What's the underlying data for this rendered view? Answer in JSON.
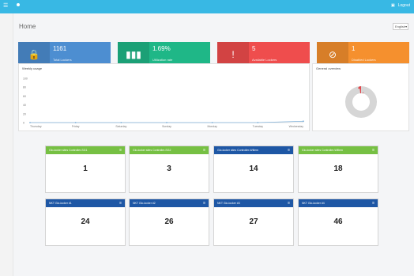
{
  "page": {
    "title": "Home",
    "language": "English"
  },
  "topbar": {
    "menu_icon": "bars-icon",
    "user": "Logout"
  },
  "stats": [
    {
      "value": "1161",
      "label": "Total Lockers",
      "color": "#4d8ed1",
      "icon": "lock-icon"
    },
    {
      "value": "1.69%",
      "label": "Utilization rate",
      "color": "#1fb787",
      "icon": "bar-chart-icon"
    },
    {
      "value": "5",
      "label": "Available Lockers",
      "color": "#ef4d4d",
      "icon": "alert-icon"
    },
    {
      "value": "1",
      "label": "Disabled Lockers",
      "color": "#f5902e",
      "icon": "ban-icon"
    }
  ],
  "weekly_panel": {
    "title": "Weekly usage"
  },
  "status_panel": {
    "title": "General overview"
  },
  "chart_data": [
    {
      "type": "line",
      "title": "Weekly usage",
      "x": [
        "Thursday",
        "Friday",
        "Saturday",
        "Sunday",
        "Monday",
        "Tuesday",
        "Wednesday"
      ],
      "series": [
        {
          "values": [
            0,
            0,
            0,
            0,
            0,
            0,
            3
          ]
        }
      ],
      "ylim": [
        0,
        100
      ],
      "yticks": [
        "100",
        "80",
        "60",
        "40",
        "20",
        "0"
      ],
      "grid": false,
      "color": "#7fb0d8"
    },
    {
      "type": "pie",
      "title": "General overview",
      "slices": [
        {
          "value": 98.3,
          "color": "#d6d6d6"
        },
        {
          "value": 1.7,
          "color": "#e0474c"
        }
      ]
    }
  ],
  "cards": [
    {
      "title": "Glo-locker sites Controller-SG1",
      "number": "1",
      "color": "green"
    },
    {
      "title": "Glo-locker sites Controller-SG2",
      "number": "3",
      "color": "green"
    },
    {
      "title": "Glo-locker sites Controller-Willem",
      "number": "14",
      "color": "blue"
    },
    {
      "title": "Glo-locker sites Controller-Willem",
      "number": "18",
      "color": "green"
    },
    {
      "title": "NKT Glo-locker #1",
      "number": "24",
      "color": "blue"
    },
    {
      "title": "NKT Glo-locker #2",
      "number": "26",
      "color": "blue"
    },
    {
      "title": "NKT Glo-locker #3",
      "number": "27",
      "color": "blue"
    },
    {
      "title": "NKT Glo-locker #4",
      "number": "46",
      "color": "blue"
    }
  ]
}
